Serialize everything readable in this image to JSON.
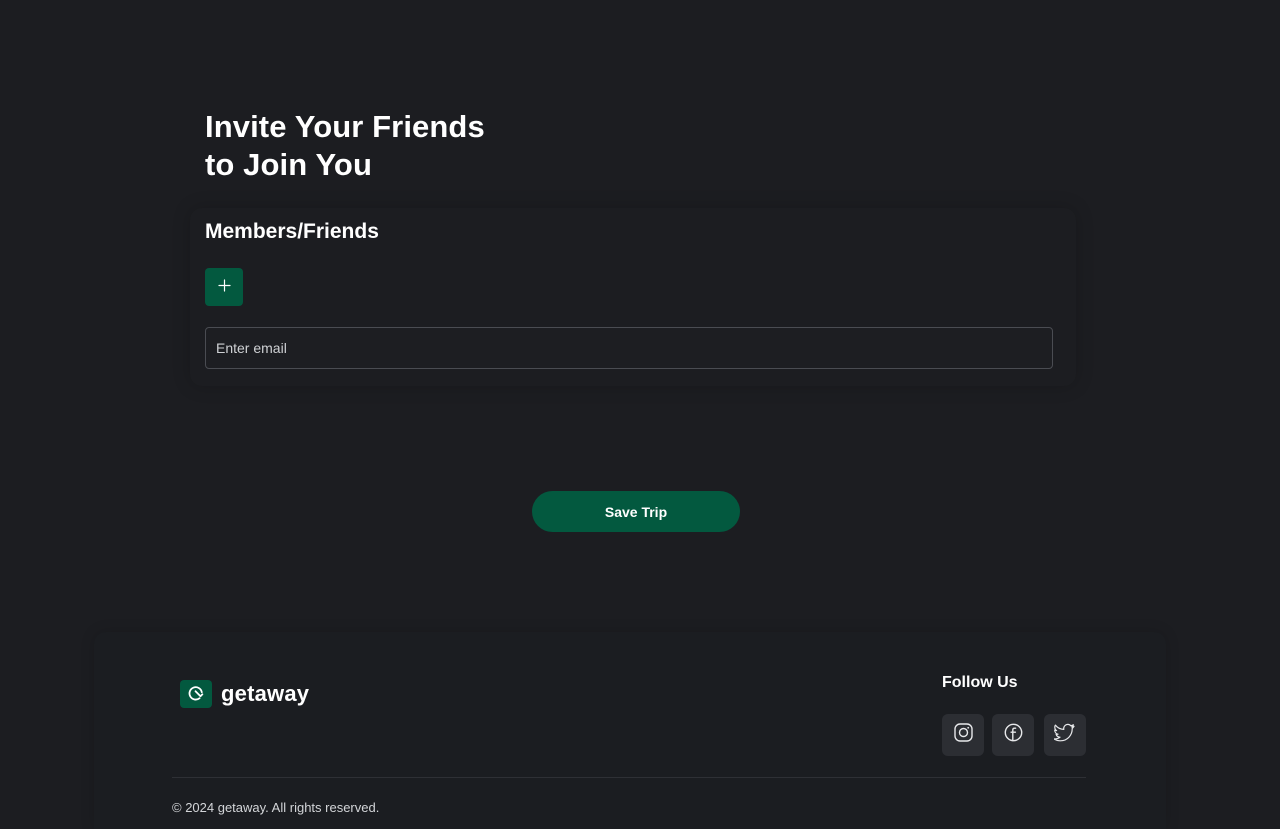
{
  "invite": {
    "heading_line1": "Invite Your Friends",
    "heading_line2": "to Join You",
    "members_title": "Members/Friends",
    "add_button_icon": "plus-icon",
    "email_placeholder": "Enter email",
    "email_value": ""
  },
  "actions": {
    "save_label": "Save Trip"
  },
  "footer": {
    "logo_icon": "getaway-logo-icon",
    "brand_name": "getaway",
    "follow_title": "Follow Us",
    "social_icons": [
      "instagram-icon",
      "facebook-icon",
      "twitter-icon"
    ],
    "copyright": "© 2024 getaway. All rights reserved."
  },
  "colors": {
    "background": "#1c1d21",
    "accent": "#03593f",
    "input_border": "#4a4c52",
    "social_button": "#2c2e33"
  }
}
